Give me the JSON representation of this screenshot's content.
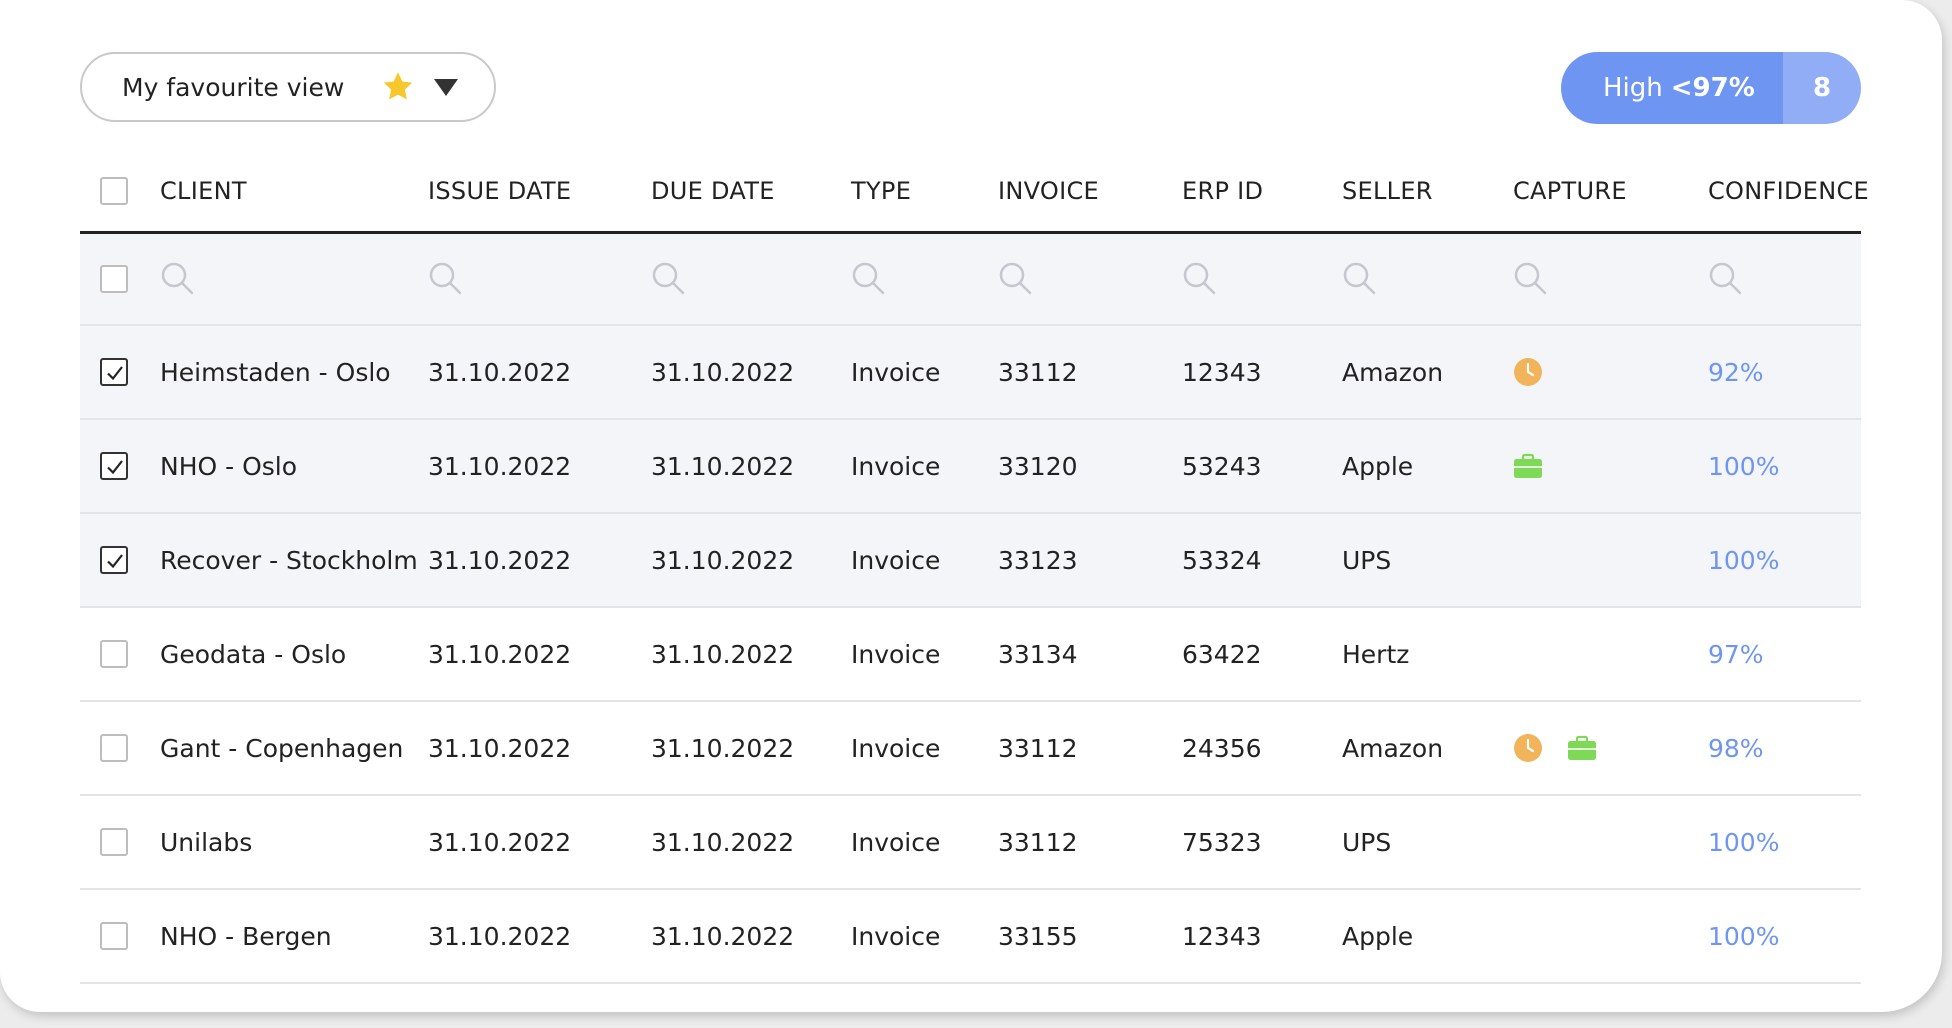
{
  "toolbar": {
    "view_label": "My favourite view",
    "filter_prefix": "High",
    "filter_value": "<97%",
    "filter_count": "8"
  },
  "colors": {
    "accent": "#6f95f3",
    "clock": "#f1b45a",
    "briefcase": "#7ed957"
  },
  "table": {
    "columns": [
      "CLIENT",
      "ISSUE DATE",
      "DUE DATE",
      "TYPE",
      "INVOICE",
      "ERP ID",
      "SELLER",
      "CAPTURE",
      "CONFIDENCE"
    ],
    "rows": [
      {
        "client": "Heimstaden - Oslo",
        "issue": "31.10.2022",
        "due": "31.10.2022",
        "type": "Invoice",
        "invoice": "33112",
        "erp": "12343",
        "seller": "Amazon",
        "capture": [
          "clock-icon"
        ],
        "confidence": "92%",
        "checked": true
      },
      {
        "client": "NHO - Oslo",
        "issue": "31.10.2022",
        "due": "31.10.2022",
        "type": "Invoice",
        "invoice": "33120",
        "erp": "53243",
        "seller": "Apple",
        "capture": [
          "briefcase-icon"
        ],
        "confidence": "100%",
        "checked": true
      },
      {
        "client": "Recover - Stockholm",
        "issue": "31.10.2022",
        "due": "31.10.2022",
        "type": "Invoice",
        "invoice": "33123",
        "erp": "53324",
        "seller": "UPS",
        "capture": [],
        "confidence": "100%",
        "checked": true
      },
      {
        "client": "Geodata - Oslo",
        "issue": "31.10.2022",
        "due": "31.10.2022",
        "type": "Invoice",
        "invoice": "33134",
        "erp": "63422",
        "seller": "Hertz",
        "capture": [],
        "confidence": "97%",
        "checked": false
      },
      {
        "client": "Gant - Copenhagen",
        "issue": "31.10.2022",
        "due": "31.10.2022",
        "type": "Invoice",
        "invoice": "33112",
        "erp": "24356",
        "seller": "Amazon",
        "capture": [
          "clock-icon",
          "briefcase-icon"
        ],
        "confidence": "98%",
        "checked": false
      },
      {
        "client": "Unilabs",
        "issue": "31.10.2022",
        "due": "31.10.2022",
        "type": "Invoice",
        "invoice": "33112",
        "erp": "75323",
        "seller": "UPS",
        "capture": [],
        "confidence": "100%",
        "checked": false
      },
      {
        "client": "NHO - Bergen",
        "issue": "31.10.2022",
        "due": "31.10.2022",
        "type": "Invoice",
        "invoice": "33155",
        "erp": "12343",
        "seller": "Apple",
        "capture": [],
        "confidence": "100%",
        "checked": false
      }
    ]
  }
}
